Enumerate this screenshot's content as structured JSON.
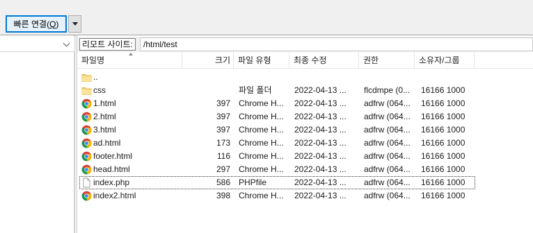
{
  "toolbar": {
    "quick_connect_label": "빠른 연결(",
    "quick_connect_mnemonic": "Q",
    "quick_connect_suffix": ")"
  },
  "remote": {
    "label": "리모트 사이트:",
    "path": "/html/test"
  },
  "columns": {
    "name": "파일명",
    "size": "크기",
    "type": "파일 유형",
    "modified": "최종 수정",
    "permissions": "권한",
    "owner": "소유자/그룹"
  },
  "files": [
    {
      "icon": "folder-icon",
      "name": "..",
      "size": "",
      "type": "",
      "modified": "",
      "permissions": "",
      "owner": ""
    },
    {
      "icon": "folder-icon",
      "name": "css",
      "size": "",
      "type": "파일 폴더",
      "modified": "2022-04-13 ...",
      "permissions": "flcdmpe (0...",
      "owner": "16166 1000"
    },
    {
      "icon": "chrome-icon",
      "name": "1.html",
      "size": "397",
      "type": "Chrome H...",
      "modified": "2022-04-13 ...",
      "permissions": "adfrw (064...",
      "owner": "16166 1000"
    },
    {
      "icon": "chrome-icon",
      "name": "2.html",
      "size": "397",
      "type": "Chrome H...",
      "modified": "2022-04-13 ...",
      "permissions": "adfrw (064...",
      "owner": "16166 1000"
    },
    {
      "icon": "chrome-icon",
      "name": "3.html",
      "size": "397",
      "type": "Chrome H...",
      "modified": "2022-04-13 ...",
      "permissions": "adfrw (064...",
      "owner": "16166 1000"
    },
    {
      "icon": "chrome-icon",
      "name": "ad.html",
      "size": "173",
      "type": "Chrome H...",
      "modified": "2022-04-13 ...",
      "permissions": "adfrw (064...",
      "owner": "16166 1000"
    },
    {
      "icon": "chrome-icon",
      "name": "footer.html",
      "size": "116",
      "type": "Chrome H...",
      "modified": "2022-04-13 ...",
      "permissions": "adfrw (064...",
      "owner": "16166 1000"
    },
    {
      "icon": "chrome-icon",
      "name": "head.html",
      "size": "297",
      "type": "Chrome H...",
      "modified": "2022-04-13 ...",
      "permissions": "adfrw (064...",
      "owner": "16166 1000"
    },
    {
      "icon": "file-icon",
      "name": "index.php",
      "size": "586",
      "type": "PHPfile",
      "modified": "2022-04-13 ...",
      "permissions": "adfrw (064...",
      "owner": "16166 1000"
    },
    {
      "icon": "chrome-icon",
      "name": "index2.html",
      "size": "398",
      "type": "Chrome H...",
      "modified": "2022-04-13 ...",
      "permissions": "adfrw (064...",
      "owner": "16166 1000"
    }
  ]
}
